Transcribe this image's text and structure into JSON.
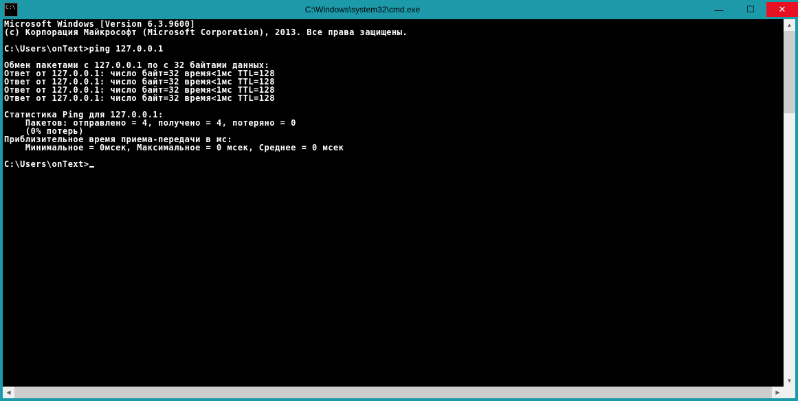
{
  "window": {
    "title": "C:\\Windows\\system32\\cmd.exe"
  },
  "console": {
    "lines": [
      "Microsoft Windows [Version 6.3.9600]",
      "(c) Корпорация Майкрософт (Microsoft Corporation), 2013. Все права защищены.",
      "",
      "C:\\Users\\onText>ping 127.0.0.1",
      "",
      "Обмен пакетами с 127.0.0.1 по с 32 байтами данных:",
      "Ответ от 127.0.0.1: число байт=32 время<1мс TTL=128",
      "Ответ от 127.0.0.1: число байт=32 время<1мс TTL=128",
      "Ответ от 127.0.0.1: число байт=32 время<1мс TTL=128",
      "Ответ от 127.0.0.1: число байт=32 время<1мс TTL=128",
      "",
      "Статистика Ping для 127.0.0.1:",
      "    Пакетов: отправлено = 4, получено = 4, потеряно = 0",
      "    (0% потерь)",
      "Приблизительное время приема-передачи в мс:",
      "    Минимальное = 0мсек, Максимальное = 0 мсек, Среднее = 0 мсек",
      "",
      "C:\\Users\\onText>"
    ],
    "prompt": "C:\\Users\\onText>"
  },
  "glyphs": {
    "minimize": "—",
    "maximize": "☐",
    "close": "✕",
    "up": "▲",
    "down": "▼",
    "left": "◀",
    "right": "▶"
  }
}
